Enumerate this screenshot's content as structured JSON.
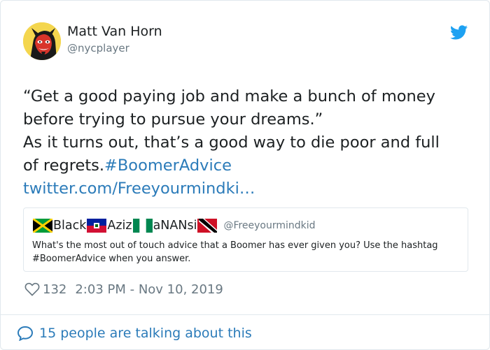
{
  "author": {
    "display_name": "Matt Van Horn",
    "screen_name": "@nycplayer",
    "avatar_icon": "devil-cartoon-avatar"
  },
  "brand": {
    "icon": "twitter-bird-icon",
    "color": "#1da1f2"
  },
  "tweet": {
    "line1": "“Get a good paying job and make a bunch of money",
    "line2": "before trying to pursue your dreams.”",
    "line3": "As it turns out, that’s a good way to die poor and full",
    "line4_text": "of regrets.",
    "hashtag": "#BoomerAdvice",
    "link": "twitter.com/Freeyourmindki…"
  },
  "quoted_tweet": {
    "name_parts": [
      "Black",
      "Aziz",
      "aNANsi"
    ],
    "flags": [
      "jamaica-flag-icon",
      "haiti-flag-icon",
      "nigeria-flag-icon",
      "trinidad-flag-icon"
    ],
    "handle": "@Freeyourmindkid",
    "text": "What's the most out of touch advice that a Boomer has ever given you? Use the hashtag #BoomerAdvice when you answer."
  },
  "meta": {
    "like_count": "132",
    "timestamp": "2:03 PM - Nov 10, 2019"
  },
  "footer": {
    "conversation": "15 people are talking about this"
  },
  "colors": {
    "link": "#2b7bb9",
    "secondary_text": "#697882",
    "border": "#e1e8ed"
  }
}
